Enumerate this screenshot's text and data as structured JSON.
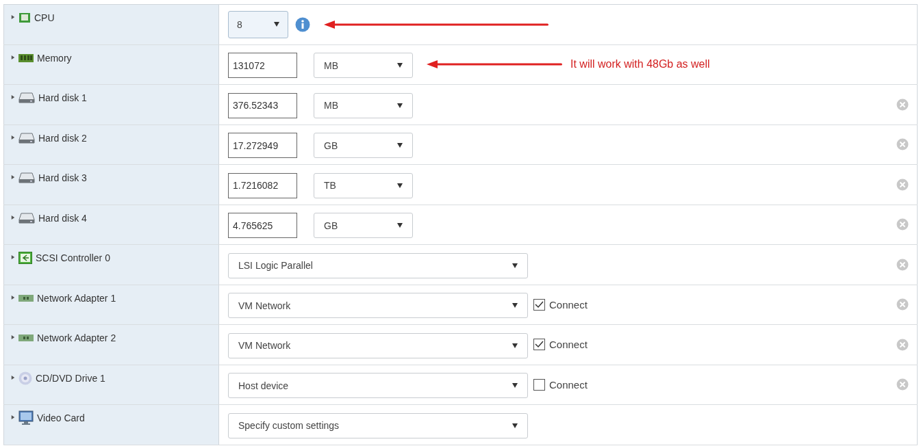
{
  "rows": [
    {
      "label": "CPU",
      "expanded": false,
      "icon": {
        "kind": "cpu"
      },
      "control": {
        "kind": "small_select",
        "select": "8"
      },
      "info": true,
      "arrow": true,
      "removable": false
    },
    {
      "label": "Memory",
      "expanded": false,
      "icon": {
        "kind": "memory"
      },
      "control": {
        "kind": "size",
        "size": "131072",
        "unit": "MB"
      },
      "arrow": true,
      "note": "It will work with 48Gb as well",
      "removable": false
    },
    {
      "label": "Hard disk 1",
      "expanded": false,
      "icon": {
        "kind": "disk"
      },
      "control": {
        "kind": "size",
        "size": "376.52343",
        "unit": "MB"
      },
      "removable": true
    },
    {
      "label": "Hard disk 2",
      "expanded": false,
      "icon": {
        "kind": "disk"
      },
      "control": {
        "kind": "size",
        "size": "17.272949",
        "unit": "GB"
      },
      "removable": true
    },
    {
      "label": "Hard disk 3",
      "expanded": false,
      "icon": {
        "kind": "disk"
      },
      "control": {
        "kind": "size",
        "size": "1.7216082",
        "unit": "TB"
      },
      "removable": true
    },
    {
      "label": "Hard disk 4",
      "expanded": false,
      "icon": {
        "kind": "disk"
      },
      "control": {
        "kind": "size",
        "size": "4.765625",
        "unit": "GB"
      },
      "removable": true
    },
    {
      "label": "SCSI Controller 0",
      "expanded": false,
      "icon": {
        "kind": "scsi"
      },
      "control": {
        "kind": "select",
        "select": "LSI Logic Parallel"
      },
      "removable": true
    },
    {
      "label": "Network Adapter 1",
      "expanded": false,
      "icon": {
        "kind": "network"
      },
      "control": {
        "kind": "select",
        "select": "VM Network"
      },
      "connect": {
        "label": "Connect",
        "checked": true
      },
      "removable": true
    },
    {
      "label": "Network Adapter 2",
      "expanded": false,
      "icon": {
        "kind": "network"
      },
      "control": {
        "kind": "select",
        "select": "VM Network"
      },
      "connect": {
        "label": "Connect",
        "checked": true
      },
      "removable": true
    },
    {
      "label": "CD/DVD Drive 1",
      "expanded": false,
      "icon": {
        "kind": "cdrom"
      },
      "control": {
        "kind": "select",
        "select": "Host device"
      },
      "connect": {
        "label": "Connect",
        "checked": false
      },
      "removable": true
    },
    {
      "label": "Video Card",
      "expanded": false,
      "icon": {
        "kind": "video"
      },
      "control": {
        "kind": "select",
        "select": "Specify custom settings"
      },
      "removable": false
    }
  ]
}
